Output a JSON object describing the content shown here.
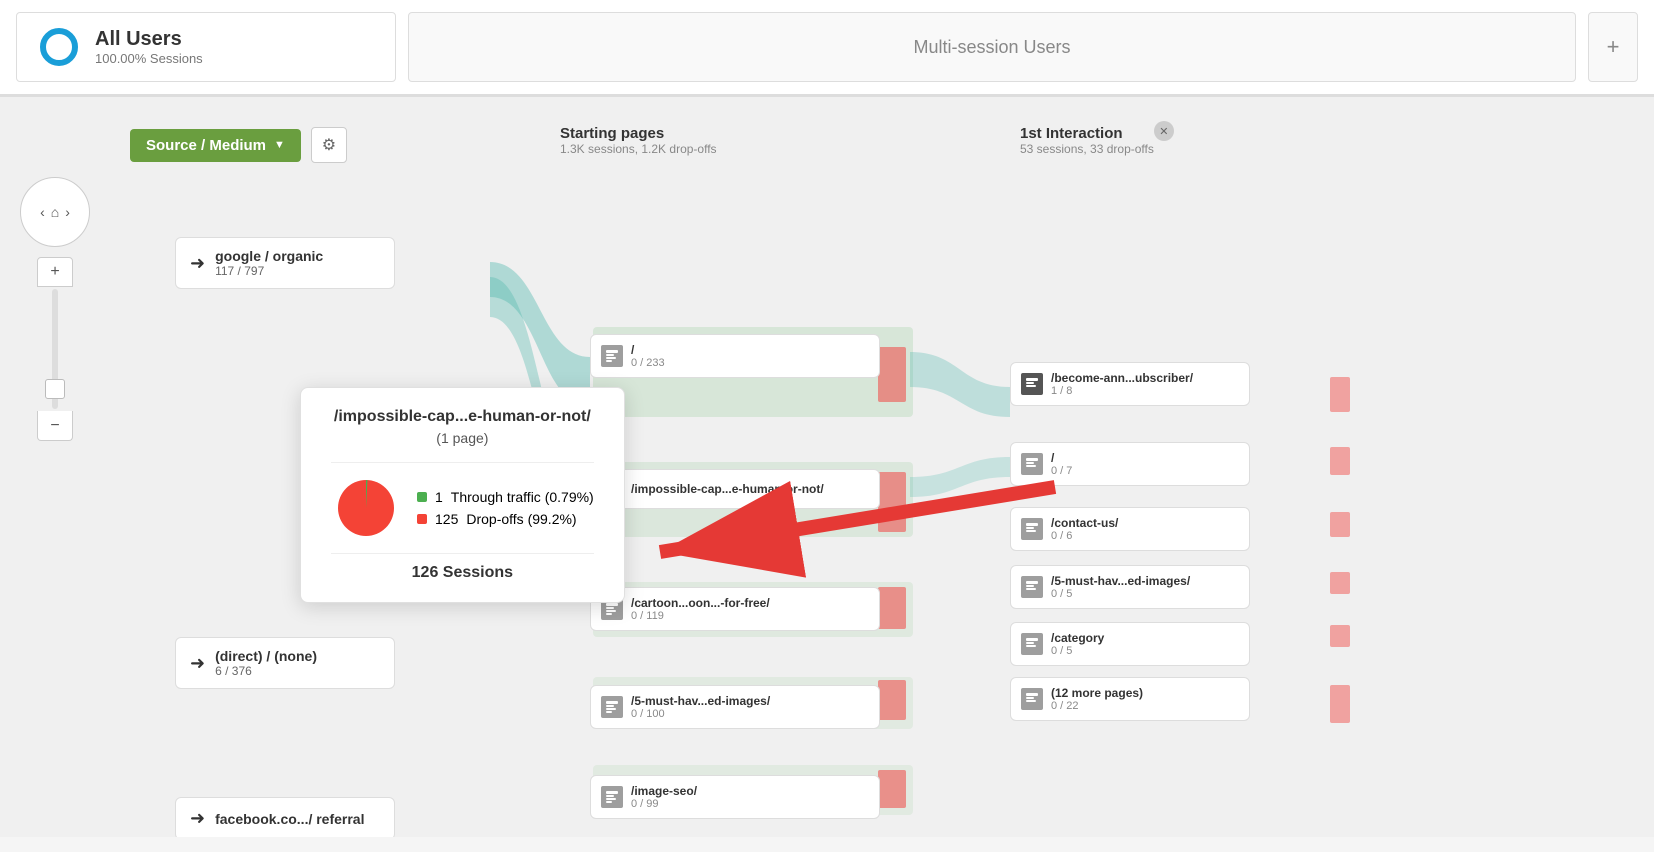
{
  "header": {
    "segment1": {
      "title": "All Users",
      "sub": "100.00% Sessions"
    },
    "segment2": {
      "title": "Multi-session Users"
    },
    "add_label": "+"
  },
  "toolbar": {
    "dimension_label": "Source / Medium",
    "settings_icon": "gear-icon"
  },
  "columns": {
    "starting_pages": {
      "title": "Starting pages",
      "sub": "1.3K sessions, 1.2K drop-offs"
    },
    "first_interaction": {
      "title": "1st Interaction",
      "sub": "53 sessions, 33 drop-offs"
    }
  },
  "source_nodes": [
    {
      "name": "google / organic",
      "count": "117 / 797"
    },
    {
      "name": "(direct) / (none)",
      "count": "6 / 376"
    },
    {
      "name": "facebook.co.../ referral",
      "count": ""
    }
  ],
  "starting_page_nodes": [
    {
      "name": "/",
      "count": "0 / 233"
    },
    {
      "name": "/impossible-cap...e-human-or-not/",
      "count": ""
    },
    {
      "name": "/cartoon...oon...-for-free/",
      "count": "0 / 119"
    },
    {
      "name": "/5-must-hav...ed-images/",
      "count": "0 / 100"
    },
    {
      "name": "/image-seo/",
      "count": "0 / 99"
    }
  ],
  "interaction_nodes": [
    {
      "name": "/become-ann...ubscriber/",
      "count": "1 / 8"
    },
    {
      "name": "/",
      "count": "0 / 7"
    },
    {
      "name": "/contact-us/",
      "count": "0 / 6"
    },
    {
      "name": "/5-must-hav...ed-images/",
      "count": "0 / 5"
    },
    {
      "name": "/category",
      "count": "0 / 5"
    },
    {
      "name": "(12 more pages)",
      "count": "0 / 22"
    }
  ],
  "tooltip": {
    "title": "/impossible-cap...e-human-or-not/",
    "subtitle": "(1 page)",
    "through_traffic_count": "1",
    "through_traffic_pct": "Through traffic (0.79%)",
    "dropoffs_count": "125",
    "dropoffs_pct": "Drop-offs (99.2%)",
    "sessions_label": "Sessions",
    "sessions_count": "126"
  },
  "colors": {
    "brand_green": "#6a9e3f",
    "flow_green": "#4db6ac",
    "dropoff_red": "#ef5350",
    "node_border": "#ddd"
  }
}
